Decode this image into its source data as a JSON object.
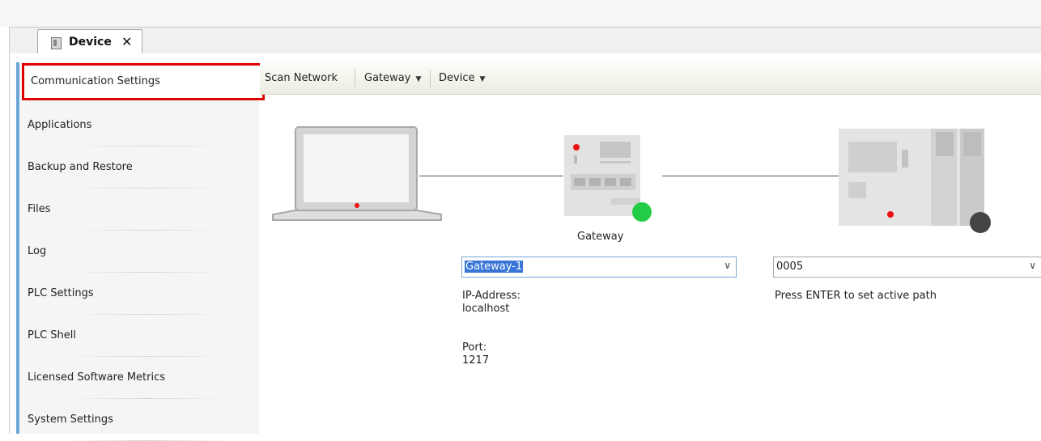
{
  "tab": {
    "label": "Device",
    "close": "✕"
  },
  "sidebar": {
    "items": [
      {
        "label": "Communication Settings"
      },
      {
        "label": "Applications"
      },
      {
        "label": "Backup and Restore"
      },
      {
        "label": "Files"
      },
      {
        "label": "Log"
      },
      {
        "label": "PLC Settings"
      },
      {
        "label": "PLC Shell"
      },
      {
        "label": "Licensed Software Metrics"
      },
      {
        "label": "System Settings"
      }
    ]
  },
  "toolbar": {
    "scan_label": "Scan Network",
    "gateway_label": "Gateway",
    "device_label": "Device"
  },
  "gateway": {
    "label": "Gateway",
    "selected": "Gateway-1",
    "ip_label": "IP-Address:",
    "ip_value": "localhost",
    "port_label": "Port:",
    "port_value": "1217",
    "status_color": "#22cc44"
  },
  "device": {
    "selected": "0005",
    "hint": "Press ENTER to set active path",
    "status_color": "#444444"
  },
  "colors": {
    "selection_border": "#e00000",
    "sidebar_accent": "#6ea6d8",
    "combo_focus": "#7aa7d4"
  }
}
